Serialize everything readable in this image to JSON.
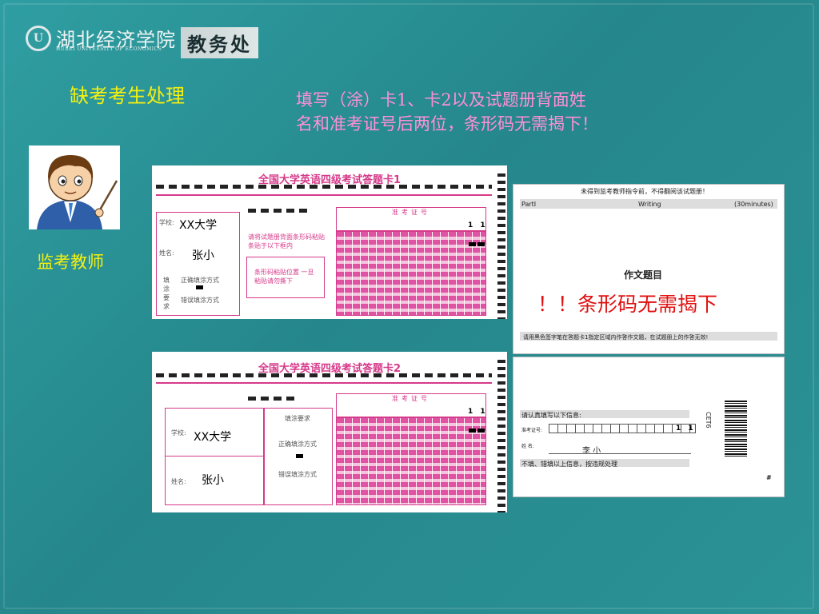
{
  "header": {
    "university_cn": "湖北经济学院",
    "university_en": "HUBEI UNIVERSITY OF ECONOMICS",
    "department": "教务处"
  },
  "slide": {
    "title": "缺考考生处理",
    "instruction_line1": "填写（涂）卡1、卡2以及试题册背面姓",
    "instruction_line2": "名和准考证号后两位，条形码无需揭下！",
    "teacher_caption": "监考教师"
  },
  "card1": {
    "title": "全国大学英语四级考试答题卡1",
    "school_label": "学校:",
    "school_value": "XX大学",
    "name_label": "姓名:",
    "name_value": "张小",
    "fill_req_label": "填 涂 要 求",
    "correct_label": "正确填涂方式",
    "wrong_label": "错误填涂方式",
    "barcode_hint": "请将试题册背面条形码粘贴条贴于以下框内",
    "paste_hint": "条形码粘贴位置 一旦粘贴请勿撕下",
    "id_header": "准考证号",
    "id_digits": "1 1"
  },
  "card2": {
    "title": "全国大学英语四级考试答题卡2",
    "school_label": "学校:",
    "school_value": "XX大学",
    "name_label": "姓名:",
    "name_value": "张小",
    "fill_req_label": "填涂要求",
    "correct_label": "正确填涂方式",
    "wrong_label": "错误填涂方式",
    "id_header": "准考证号",
    "id_digits": "1 1"
  },
  "booklet": {
    "top_notice": "未得到监考教师指令前，不得翻阅该试题册！",
    "part_label": "PartI",
    "section_label": "Writing",
    "time_label": "(30minutes)",
    "essay_label": "作文题目",
    "red_notice": "！！条形码无需揭下",
    "bottom_notice": "请用黑色签字笔在答题卡1指定区域内作答作文题，在试题册上的作答无效!",
    "confirm_label": "请认真填写以下信息:",
    "id_label": "准考证号:",
    "id_digits": "1 1",
    "name_label": "姓   名:",
    "name_value": "李  小",
    "warning": "不填、错填以上信息，按违规处理",
    "cet_label": "CET6",
    "page_mark": "#"
  },
  "colors": {
    "background": "#2a8f93",
    "title_yellow": "#f4f010",
    "note_pink": "#ff8fd6",
    "card_pink": "#d63a8a",
    "alert_red": "#e01010"
  }
}
